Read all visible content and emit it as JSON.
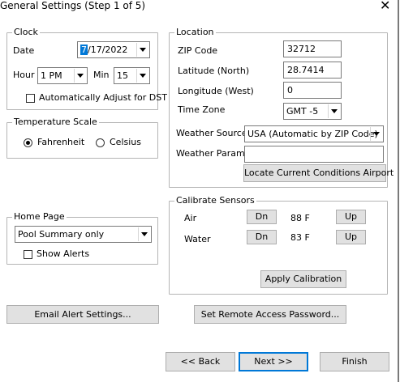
{
  "window": {
    "title": "General Settings (Step 1 of 5)",
    "close_glyph": "✕"
  },
  "clock": {
    "legend": "Clock",
    "date_label": "Date",
    "date_value_highlight": "7",
    "date_value_rest": "/17/2022",
    "hour_label": "Hour",
    "hour_value": "1 PM",
    "min_label": "Min",
    "min_value": "15",
    "auto_dst_label": "Automatically Adjust for DST",
    "auto_dst_checked": false
  },
  "temperature": {
    "legend": "Temperature Scale",
    "fahrenheit_label": "Fahrenheit",
    "celsius_label": "Celsius",
    "selected": "Fahrenheit"
  },
  "home_page": {
    "legend": "Home Page",
    "value": "Pool Summary only",
    "show_alerts_label": "Show Alerts",
    "show_alerts_checked": false
  },
  "location": {
    "legend": "Location",
    "zip_label": "ZIP Code",
    "zip_value": "32712",
    "lat_label": "Latitude (North)",
    "lat_value": "28.7414",
    "lon_label": "Longitude (West)",
    "lon_value": "0",
    "tz_label": "Time Zone",
    "tz_value": "GMT -5",
    "weather_source_label": "Weather Source",
    "weather_source_value": "USA (Automatic by ZIP Code)",
    "weather_params_label": "Weather Params",
    "weather_params_value": "",
    "locate_airport_button": "Locate Current Conditions Airport"
  },
  "calibrate": {
    "legend": "Calibrate Sensors",
    "sensors": [
      {
        "name": "Air",
        "reading": "88 F",
        "dn": "Dn",
        "up": "Up"
      },
      {
        "name": "Water",
        "reading": "83 F",
        "dn": "Dn",
        "up": "Up"
      }
    ],
    "apply_button": "Apply Calibration"
  },
  "buttons": {
    "email_alert": "Email Alert Settings...",
    "remote_password": "Set Remote Access Password...",
    "back": "<< Back",
    "next": "Next >>",
    "finish": "Finish"
  },
  "icons": {
    "dropdown": "chevron-down-icon",
    "close": "close-icon"
  }
}
